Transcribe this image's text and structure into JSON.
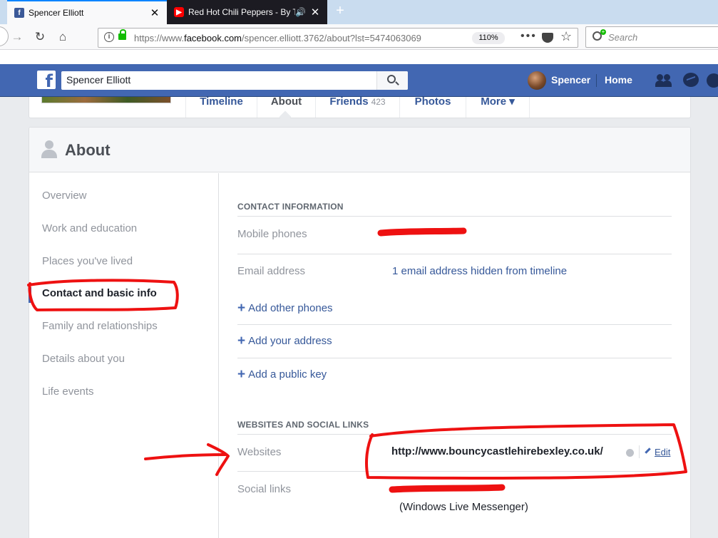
{
  "browser": {
    "tabs": [
      {
        "title": "Spencer Elliott",
        "favicon": "facebook-icon",
        "active": true
      },
      {
        "title": "Red Hot Chili Peppers - By The",
        "favicon": "youtube-icon",
        "audio": true
      }
    ],
    "url_prefix": "https://www.",
    "url_domain": "facebook.com",
    "url_path": "/spencer.elliott.3762/about?lst=5474063069",
    "zoom": "110%",
    "search_placeholder": "Search"
  },
  "fb": {
    "search_value": "Spencer Elliott",
    "user_name": "Spencer",
    "home_label": "Home",
    "brand_color": "#4267b2"
  },
  "profile_tabs": {
    "timeline": "Timeline",
    "about": "About",
    "friends": "Friends",
    "friends_count": "423",
    "photos": "Photos",
    "more": "More ▾"
  },
  "about": {
    "title": "About",
    "sidebar": [
      {
        "label": "Overview"
      },
      {
        "label": "Work and education"
      },
      {
        "label": "Places you've lived"
      },
      {
        "label": "Contact and basic info",
        "active": true
      },
      {
        "label": "Family and relationships"
      },
      {
        "label": "Details about you"
      },
      {
        "label": "Life events"
      }
    ],
    "contact": {
      "heading": "CONTACT INFORMATION",
      "mobile_label": "Mobile phones",
      "email_label": "Email address",
      "email_value": "1 email address hidden from timeline",
      "add_phones": "Add other phones",
      "add_address": "Add your address",
      "add_key": "Add a public key"
    },
    "websites": {
      "heading": "WEBSITES AND SOCIAL LINKS",
      "websites_label": "Websites",
      "website_value": "http://www.bouncycastlehirebexley.co.uk/",
      "edit_label": "Edit",
      "social_label": "Social links",
      "social_sub": "(Windows Live Messenger)"
    }
  },
  "annotation_color": "#ee1111"
}
